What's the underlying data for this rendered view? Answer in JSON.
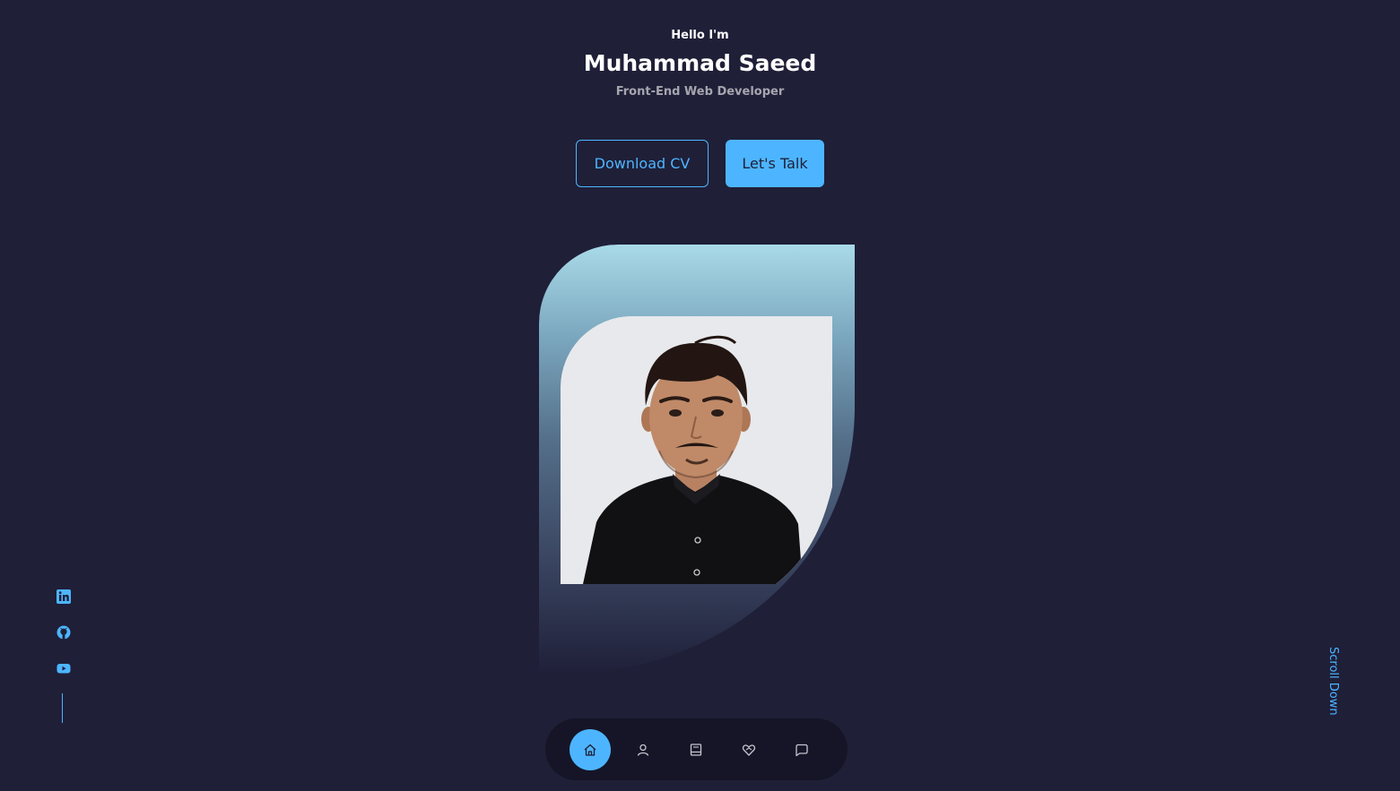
{
  "header": {
    "greeting": "Hello I'm",
    "name": "Muhammad Saeed",
    "role": "Front-End Web Developer"
  },
  "cta": {
    "download_label": "Download CV",
    "talk_label": "Let's Talk"
  },
  "portrait": {
    "alt": "Muhammad Saeed"
  },
  "socials": {
    "items": [
      {
        "icon": "linkedin-icon"
      },
      {
        "icon": "github-icon"
      },
      {
        "icon": "youtube-icon"
      }
    ]
  },
  "scroll": {
    "label": "Scroll Down"
  },
  "nav": {
    "items": [
      {
        "icon": "home-icon",
        "active": true
      },
      {
        "icon": "user-icon",
        "active": false
      },
      {
        "icon": "book-icon",
        "active": false
      },
      {
        "icon": "service-icon",
        "active": false
      },
      {
        "icon": "message-icon",
        "active": false
      }
    ]
  },
  "colors": {
    "background": "#1f1f38",
    "accent": "#4db5ff",
    "text": "#ffffff",
    "text_muted": "rgba(255,255,255,0.6)"
  }
}
